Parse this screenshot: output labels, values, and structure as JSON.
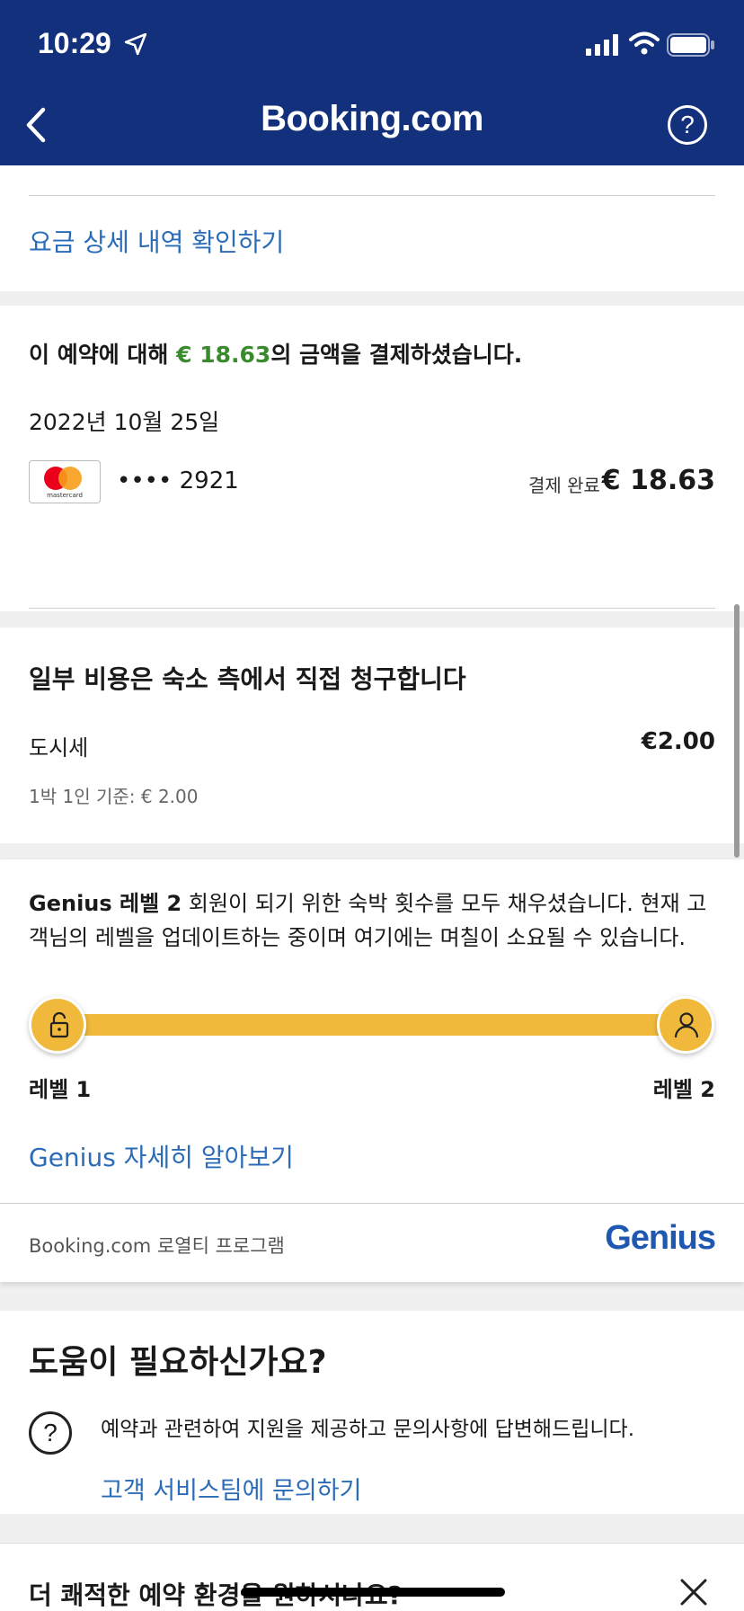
{
  "status_bar": {
    "time": "10:29"
  },
  "header": {
    "title": "Booking.com",
    "help_glyph": "?"
  },
  "price_details": {
    "link": "요금 상세 내역 확인하기"
  },
  "payment": {
    "paid_prefix": "이 예약에 대해 ",
    "paid_amount": "€ 18.63",
    "paid_suffix": "의 금액을 결제하셨습니다.",
    "date": "2022년 10월 25일",
    "card_brand": "mastercard",
    "card_number": "•••• 2921",
    "status": "결제 완료",
    "amount": "€ 18.63"
  },
  "property_charges": {
    "title": "일부 비용은 숙소 측에서 직접 청구합니다",
    "fee_label": "도시세",
    "fee_amount": "€2.00",
    "fee_sub": "1박 1인 기준:  € 2.00"
  },
  "genius": {
    "desc_bold": "Genius 레벨 2",
    "desc_rest": " 회원이 되기 위한 숙박 횟수를 모두 채우셨습니다. 현재 고객님의 레벨을 업데이트하는 중이며 여기에는 며칠이 소요될 수 있습니다.",
    "progress": 1.0,
    "level_left": "레벨 1",
    "level_right": "레벨 2",
    "learn_more": "Genius 자세히 알아보기",
    "loyalty": "Booking.com 로열티 프로그램",
    "logo": "Genius",
    "accent": "#f0b93b"
  },
  "help": {
    "title": "도움이 필요하신가요?",
    "icon_glyph": "?",
    "text": "예약과 관련하여 지원을 제공하고 문의사항에 답변해드립니다.",
    "cs_link": "고객 서비스팀에 문의하기"
  },
  "promo": {
    "title": "더 쾌적한 예약 환경을 원하시나요?"
  },
  "colors": {
    "header_bg": "#12307b",
    "link": "#2b6cb8",
    "paid_green": "#3a8a2e"
  }
}
